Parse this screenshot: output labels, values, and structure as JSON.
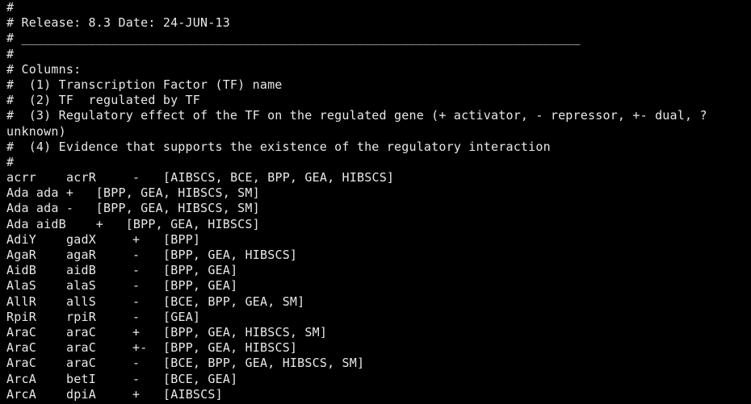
{
  "header_lines": [
    "#",
    "# Release: 8.3 Date: 24-JUN-13",
    "# ___________________________________________________________________________",
    "#",
    "# Columns:",
    "#  (1) Transcription Factor (TF) name",
    "#  (2) TF  regulated by TF",
    "#  (3) Regulatory effect of the TF on the regulated gene (+ activator, - repressor, +- dual, ?",
    "unknown)",
    "#  (4) Evidence that supports the existence of the regulatory interaction",
    "#"
  ],
  "space_rows": [
    "Ada ada +   [BPP, GEA, HIBSCS, SM]",
    "Ada ada -   [BPP, GEA, HIBSCS, SM]",
    "Ada aidB    +   [BPP, GEA, HIBSCS]"
  ],
  "rows_before": [
    {
      "tf": "acrr",
      "gene": "acrR",
      "effect": "-",
      "evidence": "[AIBSCS, BCE, BPP, GEA, HIBSCS]"
    }
  ],
  "rows_after": [
    {
      "tf": "AdiY",
      "gene": "gadX",
      "effect": "+",
      "evidence": "[BPP]"
    },
    {
      "tf": "AgaR",
      "gene": "agaR",
      "effect": "-",
      "evidence": "[BPP, GEA, HIBSCS]"
    },
    {
      "tf": "AidB",
      "gene": "aidB",
      "effect": "-",
      "evidence": "[BPP, GEA]"
    },
    {
      "tf": "AlaS",
      "gene": "alaS",
      "effect": "-",
      "evidence": "[BPP, GEA]"
    },
    {
      "tf": "AllR",
      "gene": "allS",
      "effect": "-",
      "evidence": "[BCE, BPP, GEA, SM]"
    },
    {
      "tf": "RpiR",
      "gene": "rpiR",
      "effect": "-",
      "evidence": "[GEA]"
    },
    {
      "tf": "AraC",
      "gene": "araC",
      "effect": "+",
      "evidence": "[BPP, GEA, HIBSCS, SM]"
    },
    {
      "tf": "AraC",
      "gene": "araC",
      "effect": "+-",
      "evidence": "[BPP, GEA, HIBSCS]"
    },
    {
      "tf": "AraC",
      "gene": "araC",
      "effect": "-",
      "evidence": "[BCE, BPP, GEA, HIBSCS, SM]"
    },
    {
      "tf": "ArcA",
      "gene": "betI",
      "effect": "-",
      "evidence": "[BCE, GEA]"
    },
    {
      "tf": "ArcA",
      "gene": "dpiA",
      "effect": "+",
      "evidence": "[AIBSCS]"
    }
  ],
  "colors": {
    "background": "#000000",
    "text": "#e8e8e8"
  }
}
